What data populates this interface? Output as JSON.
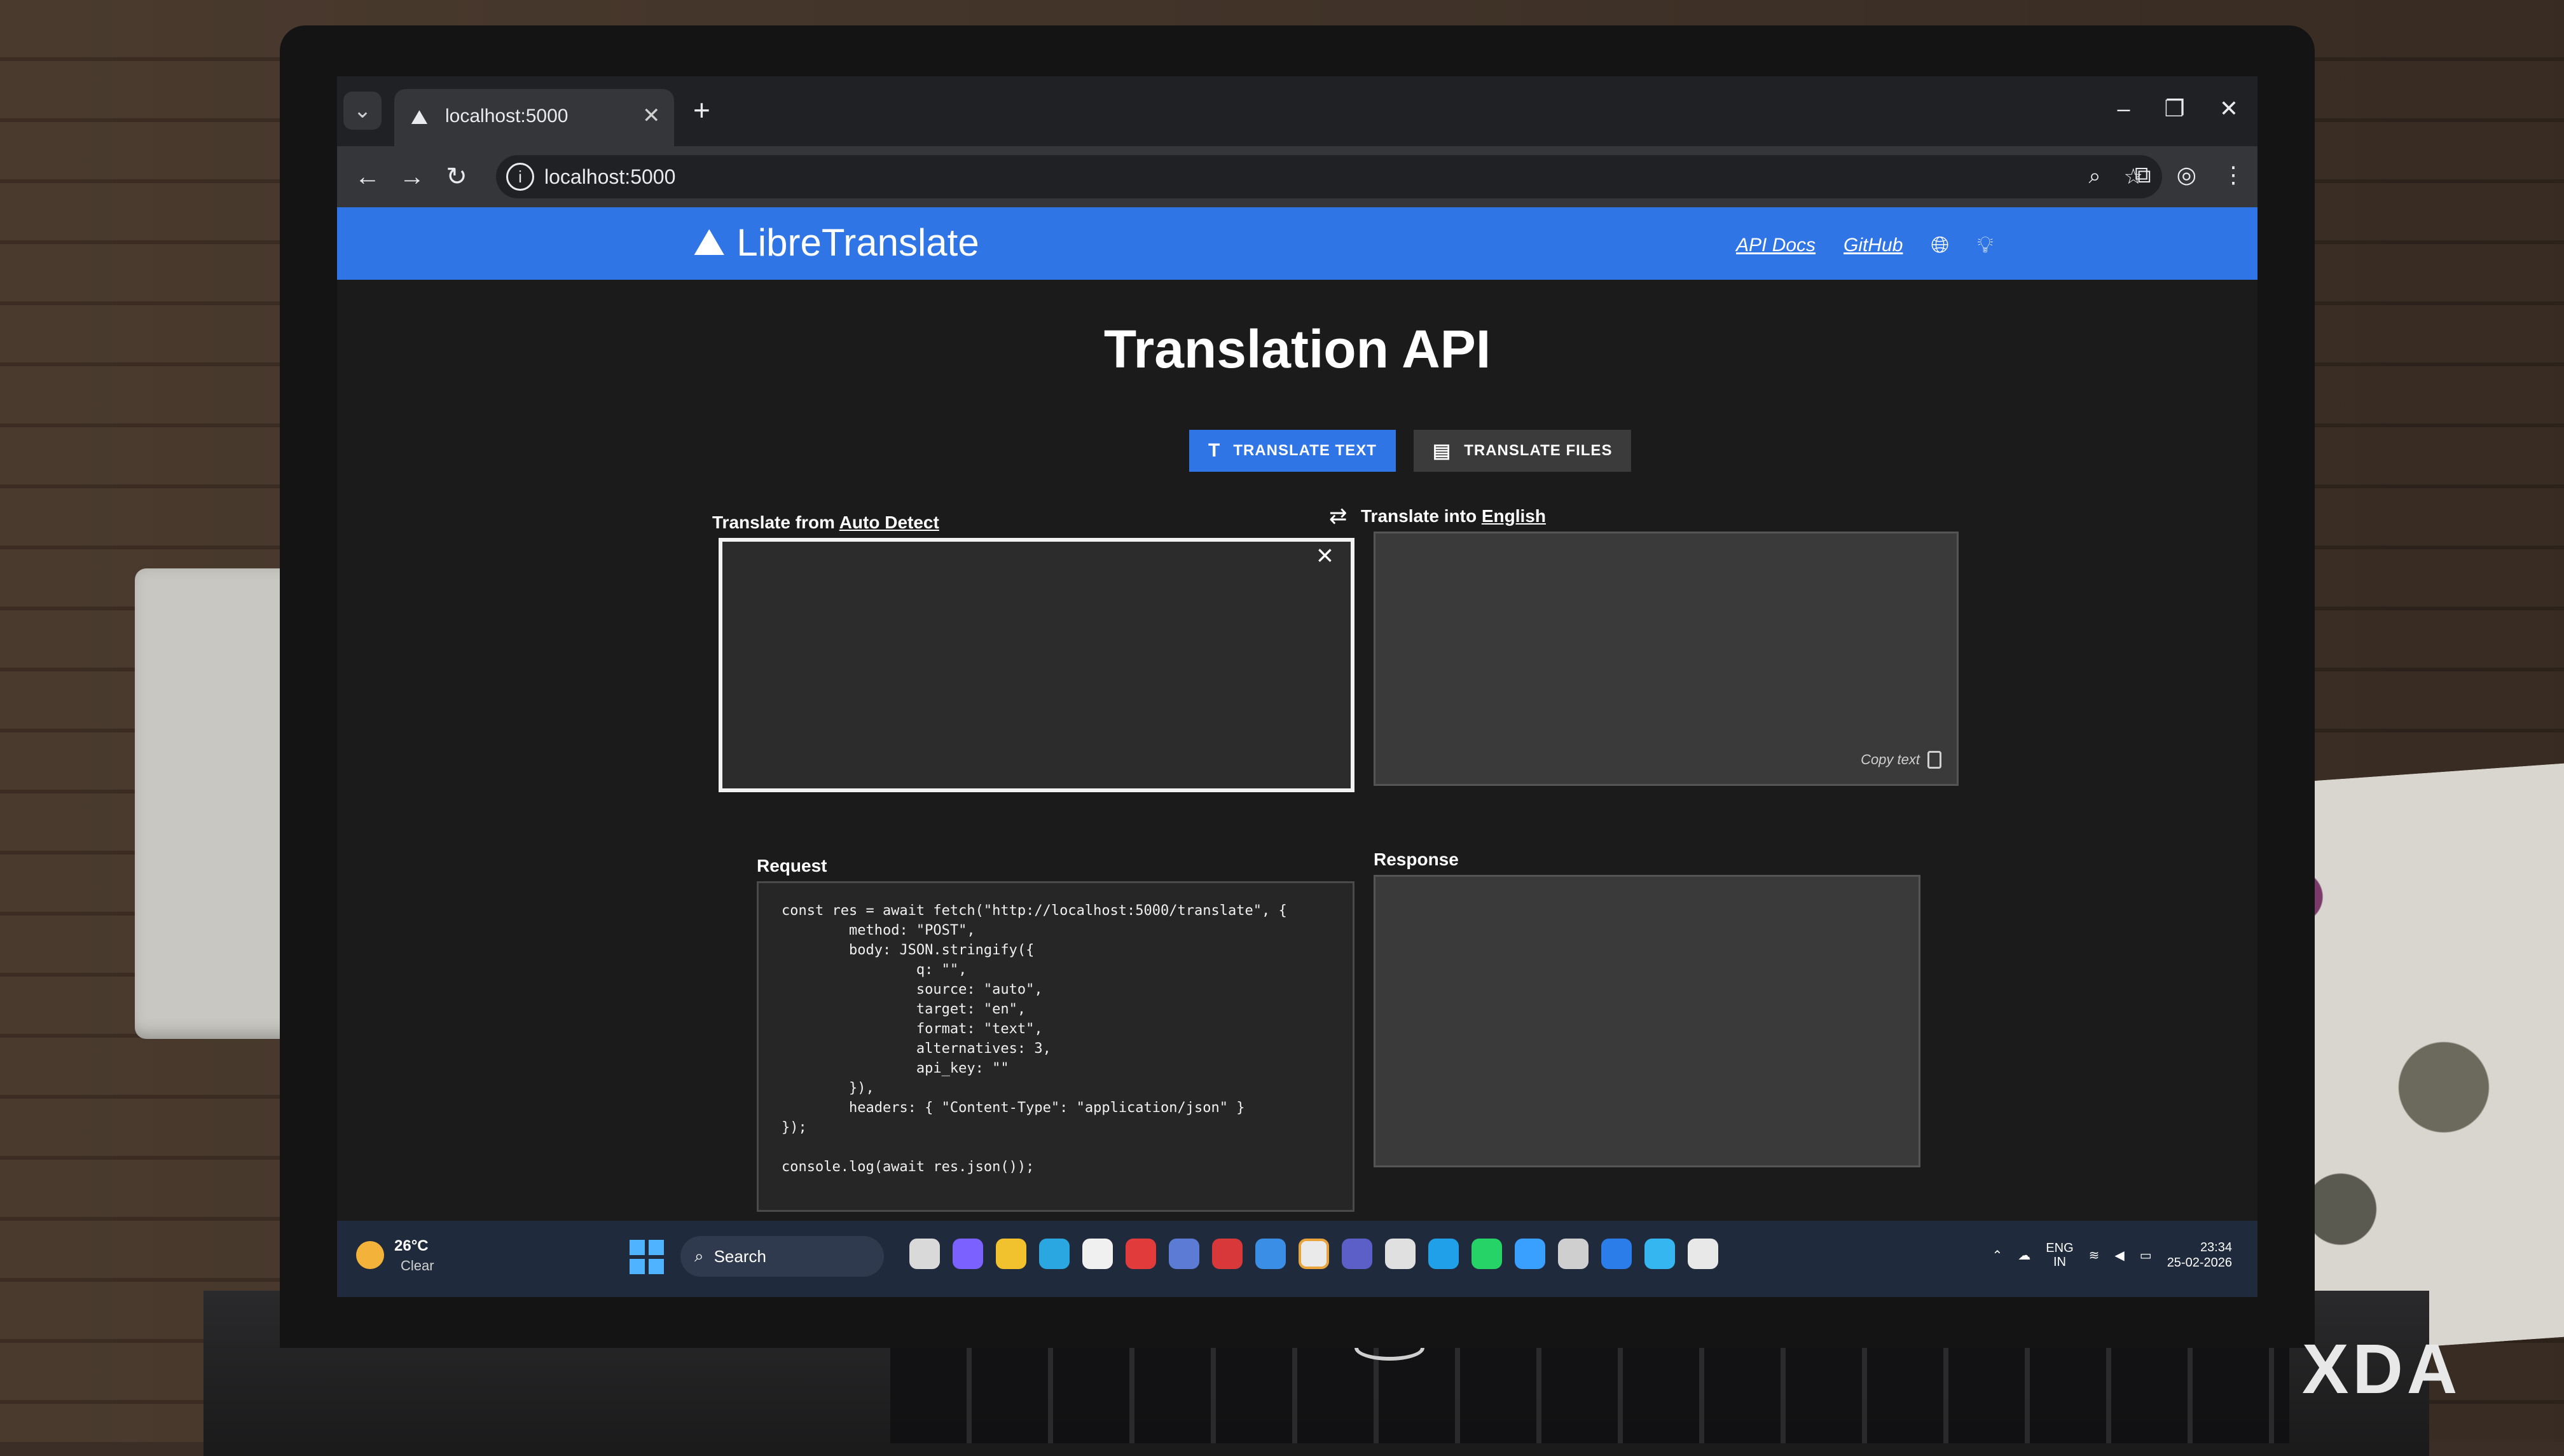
{
  "browser": {
    "tab_title": "localhost:5000",
    "new_tab_symbol": "+",
    "url": "localhost:5000",
    "window_controls": [
      "–",
      "❐",
      "✕"
    ]
  },
  "site": {
    "brand_name": "LibreTranslate",
    "nav": {
      "api_docs": "API Docs",
      "github": "GitHub"
    },
    "accent_color": "#3075e6"
  },
  "main": {
    "title": "Translation API",
    "tabs": {
      "translate_text": "TRANSLATE TEXT",
      "translate_files": "TRANSLATE FILES"
    },
    "source": {
      "prefix": "Translate from",
      "language": "Auto Detect",
      "value": ""
    },
    "target": {
      "prefix": "Translate into",
      "language": "English",
      "value": "",
      "copy_label": "Copy text"
    },
    "request_label": "Request",
    "response_label": "Response",
    "request_code": "const res = await fetch(\"http://localhost:5000/translate\", {\n\tmethod: \"POST\",\n\tbody: JSON.stringify({\n\t\tq: \"\",\n\t\tsource: \"auto\",\n\t\ttarget: \"en\",\n\t\tformat: \"text\",\n\t\talternatives: 3,\n\t\tapi_key: \"\"\n\t}),\n\theaders: { \"Content-Type\": \"application/json\" }\n});\n\nconsole.log(await res.json());",
    "response_value": ""
  },
  "taskbar": {
    "weather_temp": "26°C",
    "weather_condition": "Clear",
    "search_label": "Search",
    "tray_language": "ENG",
    "tray_region": "IN",
    "clock_time": "23:34",
    "clock_date": "25-02-2026"
  },
  "watermark": "XDA"
}
